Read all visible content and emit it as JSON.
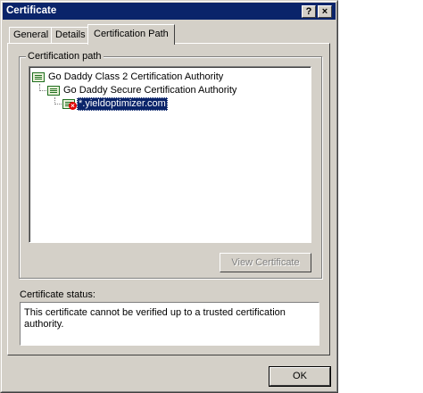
{
  "window": {
    "title": "Certificate",
    "help_label": "?",
    "close_label": "×"
  },
  "tabs": [
    {
      "label": "General"
    },
    {
      "label": "Details"
    },
    {
      "label": "Certification Path"
    }
  ],
  "path_group": {
    "label": "Certification path",
    "nodes": [
      {
        "label": "Go Daddy Class 2 Certification Authority",
        "status": "ok",
        "selected": false
      },
      {
        "label": "Go Daddy Secure Certification Authority",
        "status": "ok",
        "selected": false
      },
      {
        "label": "*.yieldoptimizer.com",
        "status": "error",
        "selected": true
      }
    ],
    "view_button": "View Certificate"
  },
  "status": {
    "label": "Certificate status:",
    "text": "This certificate cannot be verified up to a trusted certification authority."
  },
  "footer": {
    "ok_label": "OK"
  },
  "colors": {
    "titlebar": "#0a246a",
    "face": "#d4d0c8",
    "selection": "#0a246a",
    "error": "#e00000"
  }
}
